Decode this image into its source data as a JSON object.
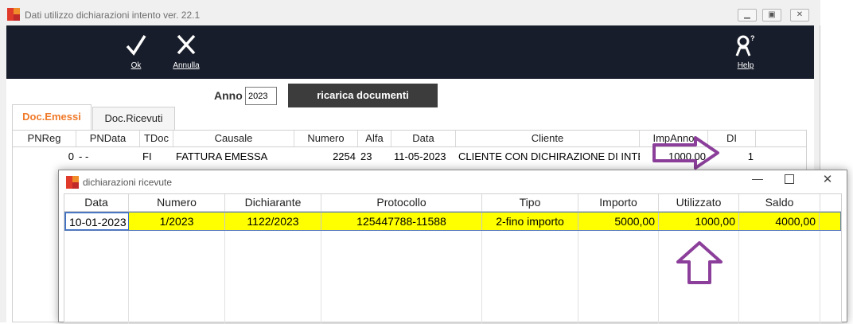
{
  "window": {
    "title": "Dati utilizzo dichiarazioni intento  ver. 22.1",
    "controls": [
      "minimize-icon",
      "restore-icon",
      "close-icon"
    ]
  },
  "toolbar": {
    "ok_label": "Ok",
    "annulla_label": "Annulla",
    "help_label": "Help"
  },
  "form": {
    "anno_label": "Anno",
    "anno_value": "2023",
    "reload_label": "ricarica documenti"
  },
  "tabs": [
    {
      "label": "Doc.Emessi",
      "active": true
    },
    {
      "label": "Doc.Ricevuti",
      "active": false
    }
  ],
  "grid": {
    "columns": [
      "PNReg",
      "PNData",
      "TDoc",
      "Causale",
      "Numero",
      "Alfa",
      "Data",
      "Cliente",
      "ImpAnno",
      "DI"
    ],
    "row": {
      "pnreg": "0",
      "pndata": "-  -",
      "tdoc": "FI",
      "causale": "FATTURA EMESSA",
      "numero": "2254",
      "alfa": "23",
      "data": "11-05-2023",
      "cliente": "CLIENTE CON DICHIRAZIONE DI INTE",
      "impanno": "1000,00",
      "di": "1"
    }
  },
  "dialog": {
    "title": "dichiarazioni  ricevute",
    "controls": [
      "minimize-icon",
      "maximize-icon",
      "close-icon"
    ],
    "columns": [
      "Data",
      "Numero",
      "Dichiarante",
      "Protocollo",
      "Tipo",
      "Importo",
      "Utilizzato",
      "Saldo"
    ],
    "row": {
      "data": "10-01-2023",
      "numero": "1/2023",
      "dichiarante": "1122/2023",
      "protocollo": "125447788-11588",
      "tipo": "2-fino importo",
      "importo": "5000,00",
      "utilizzato": "1000,00",
      "saldo": "4000,00"
    },
    "highlight_color": "#ffff00"
  },
  "colors": {
    "accent_tab": "#f07a2a",
    "toolbar_bg": "#171d2a",
    "annotation_arrow": "#8b3f9a"
  }
}
